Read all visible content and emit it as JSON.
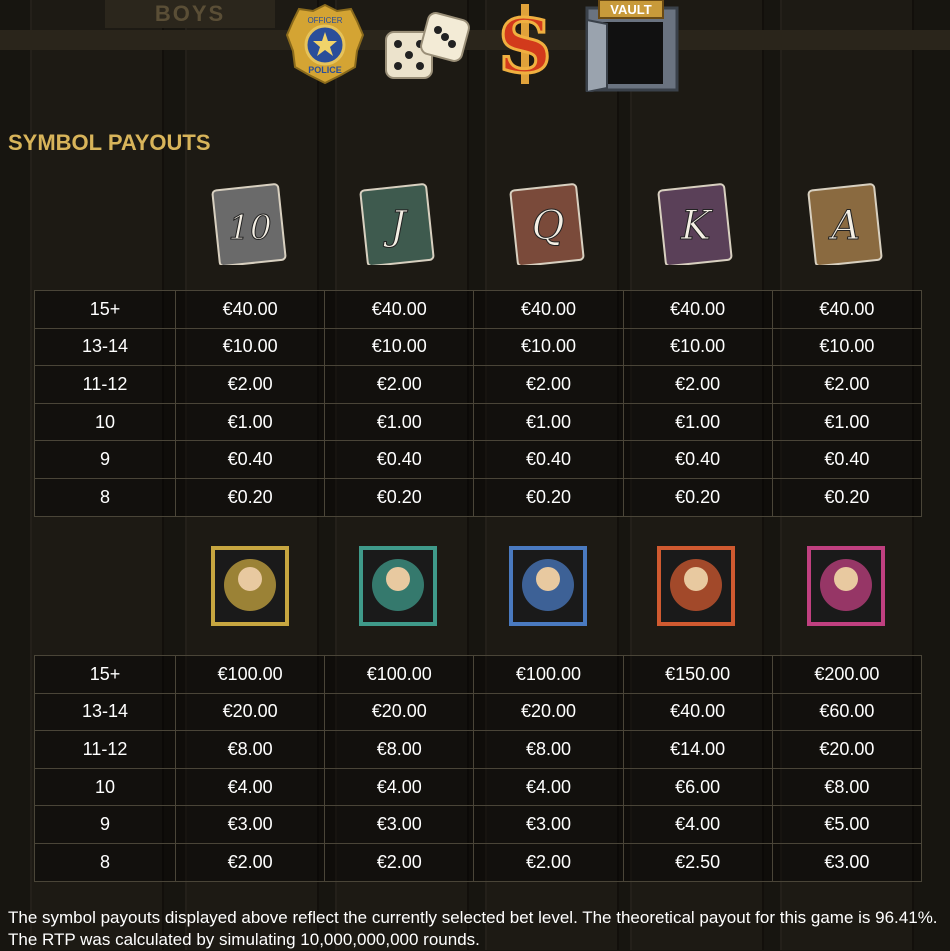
{
  "header": {
    "logo_text": "BOYS",
    "special_icons": [
      "police-badge-icon",
      "dice-icon",
      "dollar-sign-icon",
      "vault-icon"
    ],
    "badge_text_top": "OFFICER",
    "badge_text_bottom": "POLICE",
    "vault_text": "VAULT"
  },
  "section_title": "SYMBOL PAYOUTS",
  "low_symbols": {
    "icons": [
      {
        "label": "10",
        "name": "card-10-icon",
        "color": "#6a6a6a"
      },
      {
        "label": "J",
        "name": "card-j-icon",
        "color": "#3e5a4e"
      },
      {
        "label": "Q",
        "name": "card-q-icon",
        "color": "#7a4a3a"
      },
      {
        "label": "K",
        "name": "card-k-icon",
        "color": "#5a4058"
      },
      {
        "label": "A",
        "name": "card-a-icon",
        "color": "#8a6a40"
      }
    ],
    "rows": [
      {
        "level": "15+",
        "values": [
          "€40.00",
          "€40.00",
          "€40.00",
          "€40.00",
          "€40.00"
        ]
      },
      {
        "level": "13-14",
        "values": [
          "€10.00",
          "€10.00",
          "€10.00",
          "€10.00",
          "€10.00"
        ]
      },
      {
        "level": "11-12",
        "values": [
          "€2.00",
          "€2.00",
          "€2.00",
          "€2.00",
          "€2.00"
        ]
      },
      {
        "level": "10",
        "values": [
          "€1.00",
          "€1.00",
          "€1.00",
          "€1.00",
          "€1.00"
        ]
      },
      {
        "level": "9",
        "values": [
          "€0.40",
          "€0.40",
          "€0.40",
          "€0.40",
          "€0.40"
        ]
      },
      {
        "level": "8",
        "values": [
          "€0.20",
          "€0.20",
          "€0.20",
          "€0.20",
          "€0.20"
        ]
      }
    ]
  },
  "high_symbols": {
    "icons": [
      {
        "name": "mobster-icon",
        "color": "#c7a640"
      },
      {
        "name": "shoes-icon",
        "color": "#3f9a8a"
      },
      {
        "name": "gun-hand-icon",
        "color": "#4a7ac0"
      },
      {
        "name": "kissing-couple-icon",
        "color": "#d05a30"
      },
      {
        "name": "lady-with-bomb-icon",
        "color": "#c04080"
      }
    ],
    "rows": [
      {
        "level": "15+",
        "values": [
          "€100.00",
          "€100.00",
          "€100.00",
          "€150.00",
          "€200.00"
        ]
      },
      {
        "level": "13-14",
        "values": [
          "€20.00",
          "€20.00",
          "€20.00",
          "€40.00",
          "€60.00"
        ]
      },
      {
        "level": "11-12",
        "values": [
          "€8.00",
          "€8.00",
          "€8.00",
          "€14.00",
          "€20.00"
        ]
      },
      {
        "level": "10",
        "values": [
          "€4.00",
          "€4.00",
          "€4.00",
          "€6.00",
          "€8.00"
        ]
      },
      {
        "level": "9",
        "values": [
          "€3.00",
          "€3.00",
          "€3.00",
          "€4.00",
          "€5.00"
        ]
      },
      {
        "level": "8",
        "values": [
          "€2.00",
          "€2.00",
          "€2.00",
          "€2.50",
          "€3.00"
        ]
      }
    ]
  },
  "footnote": "The symbol payouts displayed above reflect the currently selected bet level. The theoretical payout for this game is 96.41%. The RTP was calculated by simulating 10,000,000,000 rounds."
}
